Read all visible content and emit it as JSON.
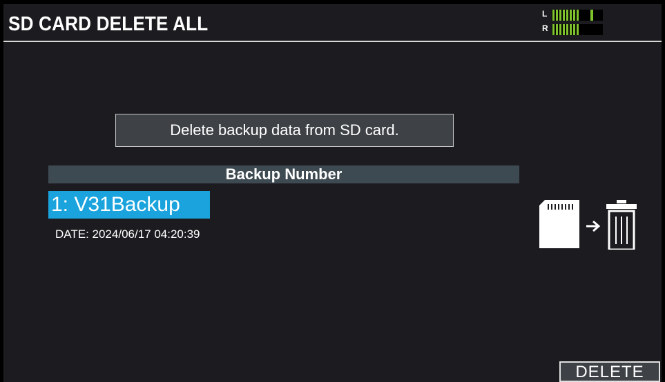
{
  "screen": {
    "title": "SD CARD DELETE ALL"
  },
  "level_meter": {
    "left_label": "L",
    "right_label": "R",
    "color": "#7fc22e",
    "left_level": 0.55,
    "right_level": 0.55,
    "left_peak": 0.75
  },
  "message": "Delete backup data from SD card.",
  "backup_list": {
    "header": "Backup Number",
    "selected_item": "1: V31Backup",
    "selected_date": "DATE: 2024/06/17 04:20:39"
  },
  "icons": {
    "sd_card": "sd-card-icon",
    "arrow": "arrow-right-icon",
    "trash": "trash-icon"
  },
  "buttons": {
    "delete_label": "DELETE"
  },
  "colors": {
    "background": "#1c1c20",
    "highlight": "#1aa3dd",
    "panel": "#3e4246"
  }
}
